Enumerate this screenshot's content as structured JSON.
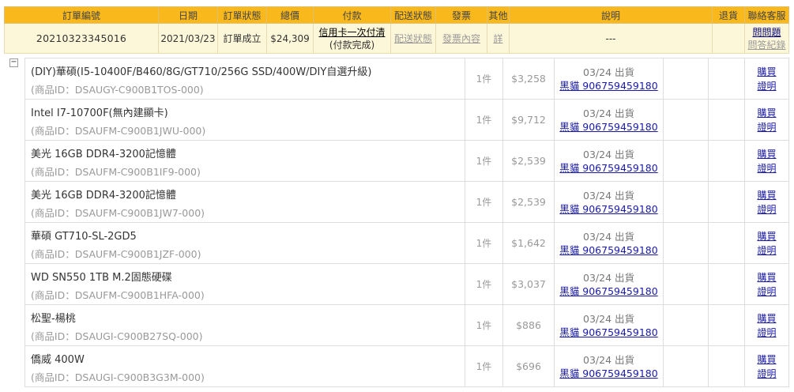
{
  "order": {
    "headers": [
      "訂單編號",
      "日期",
      "訂單狀態",
      "總價",
      "付款",
      "配送狀態",
      "發票",
      "其他",
      "說明",
      "退貨",
      "聯絡客服"
    ],
    "order_no": "20210323345016",
    "date": "2021/03/23",
    "status": "訂單成立",
    "total": "$24,309",
    "payment_link": "信用卡一次付清",
    "payment_status": "(付款完成)",
    "shipping_link": "配送狀態",
    "invoice_link": "發票內容",
    "other_link": "詳",
    "description": "---",
    "return": "",
    "contact_ask": "問問題",
    "contact_reply": "問答紀錄"
  },
  "toggle_symbol": "−",
  "items": [
    {
      "name": "(DIY)華碩(I5-10400F/B460/8G/GT710/256G SSD/400W/DIY自選升級)",
      "pid": "(商品ID：DSAUGY-C900B1TOS-000)",
      "qty": "1件",
      "price": "$3,258",
      "ship_date": "03/24 出貨",
      "carrier": "黑貓 906759459180",
      "buy": "購買",
      "proof": "證明"
    },
    {
      "name": "Intel I7-10700F(無內建顯卡)",
      "pid": "(商品ID：DSAUFM-C900B1JWU-000)",
      "qty": "1件",
      "price": "$9,712",
      "ship_date": "03/24 出貨",
      "carrier": "黑貓 906759459180",
      "buy": "購買",
      "proof": "證明"
    },
    {
      "name": "美光 16GB DDR4-3200記憶體",
      "pid": "(商品ID：DSAUFM-C900B1IF9-000)",
      "qty": "1件",
      "price": "$2,539",
      "ship_date": "03/24 出貨",
      "carrier": "黑貓 906759459180",
      "buy": "購買",
      "proof": "證明"
    },
    {
      "name": "美光 16GB DDR4-3200記憶體",
      "pid": "(商品ID：DSAUFM-C900B1JW7-000)",
      "qty": "1件",
      "price": "$2,539",
      "ship_date": "03/24 出貨",
      "carrier": "黑貓 906759459180",
      "buy": "購買",
      "proof": "證明"
    },
    {
      "name": "華碩 GT710-SL-2GD5",
      "pid": "(商品ID：DSAUFM-C900B1JZF-000)",
      "qty": "1件",
      "price": "$1,642",
      "ship_date": "03/24 出貨",
      "carrier": "黑貓 906759459180",
      "buy": "購買",
      "proof": "證明"
    },
    {
      "name": "WD SN550 1TB M.2固態硬碟",
      "pid": "(商品ID：DSAUFM-C900B1HFA-000)",
      "qty": "1件",
      "price": "$3,037",
      "ship_date": "03/24 出貨",
      "carrier": "黑貓 906759459180",
      "buy": "購買",
      "proof": "證明"
    },
    {
      "name": "松聖-楊桃",
      "pid": "(商品ID：DSAUGI-C900B27SQ-000)",
      "qty": "1件",
      "price": "$886",
      "ship_date": "03/24 出貨",
      "carrier": "黑貓 906759459180",
      "buy": "購買",
      "proof": "證明"
    },
    {
      "name": "僑威 400W",
      "pid": "(商品ID：DSAUGI-C900B3G3M-000)",
      "qty": "1件",
      "price": "$696",
      "ship_date": "03/24 出貨",
      "carrier": "黑貓 906759459180",
      "buy": "購買",
      "proof": "證明"
    }
  ]
}
